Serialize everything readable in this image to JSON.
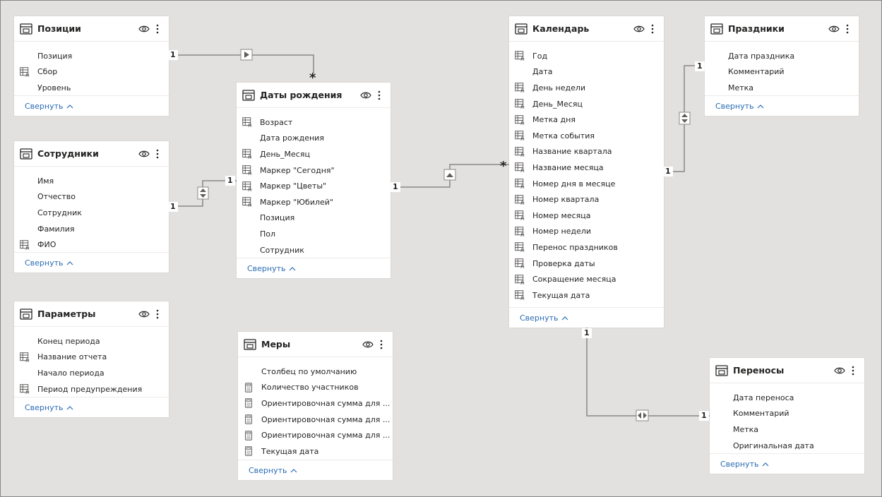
{
  "tables": [
    {
      "id": "pos",
      "title": "Позиции",
      "footer": "Свернуть",
      "fields": [
        {
          "name": "Позиция",
          "icon": "none"
        },
        {
          "name": "Сбор",
          "icon": "calc-column"
        },
        {
          "name": "Уровень",
          "icon": "none"
        }
      ]
    },
    {
      "id": "emp",
      "title": "Сотрудники",
      "footer": "Свернуть",
      "fields": [
        {
          "name": "Имя",
          "icon": "none"
        },
        {
          "name": "Отчество",
          "icon": "none"
        },
        {
          "name": "Сотрудник",
          "icon": "none"
        },
        {
          "name": "Фамилия",
          "icon": "none"
        },
        {
          "name": "ФИО",
          "icon": "calc-column"
        }
      ]
    },
    {
      "id": "par",
      "title": "Параметры",
      "footer": "Свернуть",
      "fields": [
        {
          "name": "Конец периода",
          "icon": "none"
        },
        {
          "name": "Название отчета",
          "icon": "calc-column"
        },
        {
          "name": "Начало периода",
          "icon": "none"
        },
        {
          "name": "Период предупреждения",
          "icon": "calc-column"
        }
      ]
    },
    {
      "id": "bd",
      "title": "Даты рождения",
      "footer": "Свернуть",
      "fields": [
        {
          "name": "Возраст",
          "icon": "calc-column"
        },
        {
          "name": "Дата рождения",
          "icon": "none"
        },
        {
          "name": "День_Месяц",
          "icon": "calc-column"
        },
        {
          "name": "Маркер \"Сегодня\"",
          "icon": "calc-column"
        },
        {
          "name": "Маркер \"Цветы\"",
          "icon": "calc-column"
        },
        {
          "name": "Маркер \"Юбилей\"",
          "icon": "calc-column"
        },
        {
          "name": "Позиция",
          "icon": "none"
        },
        {
          "name": "Пол",
          "icon": "none"
        },
        {
          "name": "Сотрудник",
          "icon": "none"
        }
      ]
    },
    {
      "id": "mes",
      "title": "Меры",
      "footer": "Свернуть",
      "fields": [
        {
          "name": "Столбец по умолчанию",
          "icon": "none"
        },
        {
          "name": "Количество участников",
          "icon": "measure"
        },
        {
          "name": "Ориентировочная сумма для ...",
          "icon": "measure"
        },
        {
          "name": "Ориентировочная сумма для ...",
          "icon": "measure"
        },
        {
          "name": "Ориентировочная сумма для ...",
          "icon": "measure"
        },
        {
          "name": "Текущая дата",
          "icon": "measure"
        }
      ]
    },
    {
      "id": "cal",
      "title": "Календарь",
      "footer": "Свернуть",
      "fields": [
        {
          "name": "Год",
          "icon": "calc-column"
        },
        {
          "name": "Дата",
          "icon": "none"
        },
        {
          "name": "День недели",
          "icon": "calc-column"
        },
        {
          "name": "День_Месяц",
          "icon": "calc-column"
        },
        {
          "name": "Метка дня",
          "icon": "calc-column"
        },
        {
          "name": "Метка события",
          "icon": "calc-column"
        },
        {
          "name": "Название квартала",
          "icon": "calc-column"
        },
        {
          "name": "Название месяца",
          "icon": "calc-column"
        },
        {
          "name": "Номер дня в месяце",
          "icon": "calc-column"
        },
        {
          "name": "Номер квартала",
          "icon": "calc-column"
        },
        {
          "name": "Номер месяца",
          "icon": "calc-column"
        },
        {
          "name": "Номер недели",
          "icon": "calc-column"
        },
        {
          "name": "Перенос праздников",
          "icon": "calc-column"
        },
        {
          "name": "Проверка даты",
          "icon": "calc-column"
        },
        {
          "name": "Сокращение месяца",
          "icon": "calc-column"
        },
        {
          "name": "Текущая дата",
          "icon": "calc-column"
        }
      ]
    },
    {
      "id": "hol",
      "title": "Праздники",
      "footer": "Свернуть",
      "fields": [
        {
          "name": "Дата праздника",
          "icon": "none"
        },
        {
          "name": "Комментарий",
          "icon": "none"
        },
        {
          "name": "Метка",
          "icon": "none"
        }
      ]
    },
    {
      "id": "tr",
      "title": "Переносы",
      "footer": "Свернуть",
      "fields": [
        {
          "name": "Дата переноса",
          "icon": "none"
        },
        {
          "name": "Комментарий",
          "icon": "none"
        },
        {
          "name": "Метка",
          "icon": "none"
        },
        {
          "name": "Оригинальная дата",
          "icon": "none"
        }
      ]
    }
  ],
  "relationships": [
    {
      "from": "pos",
      "to": "bd",
      "from_card": "1",
      "to_card": "*",
      "direction": "single"
    },
    {
      "from": "emp",
      "to": "bd",
      "from_card": "1",
      "to_card": "1",
      "direction": "both"
    },
    {
      "from": "bd",
      "to": "cal",
      "from_card": "1",
      "to_card": "*",
      "direction": "single"
    },
    {
      "from": "cal",
      "to": "hol",
      "from_card": "1",
      "to_card": "1",
      "direction": "both"
    },
    {
      "from": "cal",
      "to": "tr",
      "from_card": "1",
      "to_card": "1",
      "direction": "both"
    }
  ],
  "colors": {
    "canvas": "#e3e1df",
    "card": "#ffffff",
    "link": "#2a6cb5",
    "line": "#8a8886"
  }
}
